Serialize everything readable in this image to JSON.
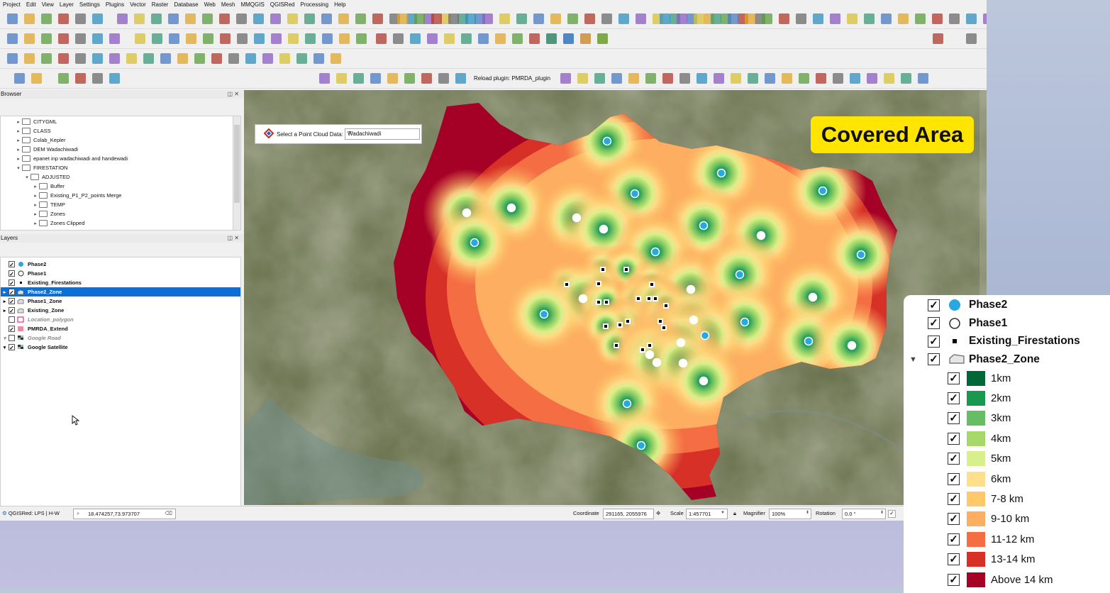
{
  "menu": [
    "Project",
    "Edit",
    "View",
    "Layer",
    "Settings",
    "Plugins",
    "Vector",
    "Raster",
    "Database",
    "Web",
    "Mesh",
    "MMQGIS",
    "QGISRed",
    "Processing",
    "Help"
  ],
  "toolbar": {
    "reload_label": "Reload plugin: PMRDA_plugin"
  },
  "browser": {
    "title": "Browser",
    "items": [
      {
        "label": "CITYGML",
        "level": 1
      },
      {
        "label": "CLASS",
        "level": 1
      },
      {
        "label": "Colab_Kepler",
        "level": 1
      },
      {
        "label": "DEM Wadachiwadi",
        "level": 1
      },
      {
        "label": "epanet inp wadachiwadi and handewadi",
        "level": 1
      },
      {
        "label": "FIRESTATION",
        "level": 1,
        "open": true
      },
      {
        "label": "ADJUSTED",
        "level": 2,
        "open": true
      },
      {
        "label": "Buffer",
        "level": 3
      },
      {
        "label": "Existing_P1_P2_points Merge",
        "level": 3
      },
      {
        "label": "TEMP",
        "level": 3
      },
      {
        "label": "Zones",
        "level": 3
      },
      {
        "label": "Zones Clipped",
        "level": 3
      }
    ]
  },
  "layers": {
    "title": "Layers",
    "items": [
      {
        "label": "Phase2",
        "checked": true,
        "symbol": "blue-dot"
      },
      {
        "label": "Phase1",
        "checked": true,
        "symbol": "white-dot"
      },
      {
        "label": "Existing_Firestations",
        "checked": true,
        "symbol": "black-square"
      },
      {
        "label": "Phase2_Zone",
        "checked": true,
        "symbol": "polygon",
        "selected": true
      },
      {
        "label": "Phase1_Zone",
        "checked": true,
        "symbol": "polygon"
      },
      {
        "label": "Existing_Zone",
        "checked": true,
        "symbol": "polygon"
      },
      {
        "label": "Location_polygon",
        "checked": false,
        "symbol": "pink-outline",
        "gray": true
      },
      {
        "label": "PMRDA_Extend",
        "checked": true,
        "symbol": "pink-fill"
      },
      {
        "label": "Google Road",
        "checked": false,
        "symbol": "grid",
        "gray": true
      },
      {
        "label": "Google Satellite",
        "checked": true,
        "symbol": "grid"
      }
    ]
  },
  "pointcloud": {
    "label": "Select a Point Cloud Data:",
    "value": "Wadachiwadi"
  },
  "overlay_title": "Covered Area",
  "status": {
    "plugin": "QGISRed: LPS | H-W",
    "coords_search": "18.474257,73.973707",
    "coordinate_label": "Coordinate",
    "coordinate_value": "291165, 2055976",
    "scale_label": "Scale",
    "scale_value": "1:457701",
    "magnifier_label": "Magnifier",
    "magnifier_value": "100%",
    "rotation_label": "Rotation",
    "rotation_value": "0.0 °"
  },
  "legend": {
    "top": [
      {
        "label": "Phase2",
        "symbol": "blue-dot"
      },
      {
        "label": "Phase1",
        "symbol": "white-dot"
      },
      {
        "label": "Existing_Firestations",
        "symbol": "black-square"
      },
      {
        "label": "Phase2_Zone",
        "symbol": "polygon"
      }
    ],
    "classes": [
      {
        "label": "1km",
        "color": "#006837"
      },
      {
        "label": "2km",
        "color": "#1a9850"
      },
      {
        "label": "3km",
        "color": "#66bd63"
      },
      {
        "label": "4km",
        "color": "#a6d96a"
      },
      {
        "label": "5km",
        "color": "#d9ef8b"
      },
      {
        "label": "6km",
        "color": "#fee08b"
      },
      {
        "label": "7-8 km",
        "color": "#fdc96b"
      },
      {
        "label": "9-10 km",
        "color": "#fdae61"
      },
      {
        "label": "11-12 km",
        "color": "#f46d43"
      },
      {
        "label": "13-14 km",
        "color": "#d73027"
      },
      {
        "label": "Above 14 km",
        "color": "#a50026"
      }
    ]
  }
}
